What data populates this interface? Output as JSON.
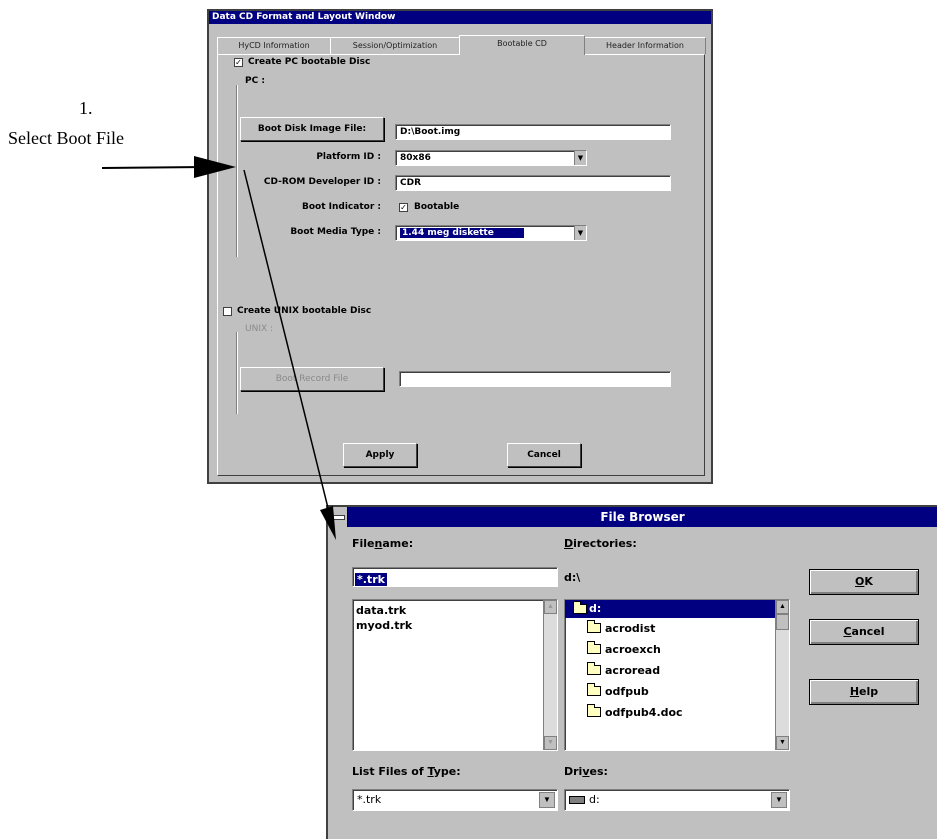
{
  "annotation": {
    "step_number": "1.",
    "step_text": "Select Boot File"
  },
  "layout_window": {
    "title": "Data CD Format and Layout Window",
    "tabs": [
      "HyCD Information",
      "Session/Optimization",
      "Bootable CD",
      "Header Information"
    ],
    "active_tab": "Bootable CD",
    "pc_checkbox_label": "Create PC bootable Disc",
    "pc_checkbox_checked": true,
    "pc_group_label": "PC :",
    "boot_image_button": "Boot Disk Image File:",
    "boot_image_value": "D:\\Boot.img",
    "platform_label": "Platform ID :",
    "platform_value": "80x86",
    "developer_label": "CD-ROM Developer ID :",
    "developer_value": "CDR",
    "indicator_label": "Boot Indicator :",
    "indicator_checkbox_label": "Bootable",
    "indicator_checked": true,
    "media_label": "Boot Media Type :",
    "media_value": "1.44 meg diskette",
    "unix_checkbox_label": "Create UNIX bootable Disc",
    "unix_checkbox_checked": false,
    "unix_group_label": "UNIX :",
    "boot_record_button": "Boot Record File",
    "boot_record_value": "",
    "apply_button": "Apply",
    "cancel_button": "Cancel"
  },
  "file_browser": {
    "title": "File Browser",
    "filename_label_pre": "File",
    "filename_label_ul": "n",
    "filename_label_post": "ame:",
    "filename_value": "*.trk",
    "files": [
      "data.trk",
      "myod.trk"
    ],
    "directories_label_ul": "D",
    "directories_label_post": "irectories:",
    "current_dir": "d:\\",
    "dirs": [
      "d:",
      "acrodist",
      "acroexch",
      "acroread",
      "odfpub",
      "odfpub4.doc"
    ],
    "type_label_pre": "List Files of ",
    "type_label_ul": "T",
    "type_label_post": "ype:",
    "type_value": "*.trk",
    "drives_label_pre": "Dri",
    "drives_label_ul": "v",
    "drives_label_post": "es:",
    "drive_value": "d:",
    "ok_ul": "O",
    "ok_post": "K",
    "cancel_ul": "C",
    "cancel_post": "ancel",
    "help_ul": "H",
    "help_post": "elp"
  },
  "colors": {
    "titlebar": "#000080",
    "selection": "#000080",
    "face": "#c0c0c0"
  }
}
